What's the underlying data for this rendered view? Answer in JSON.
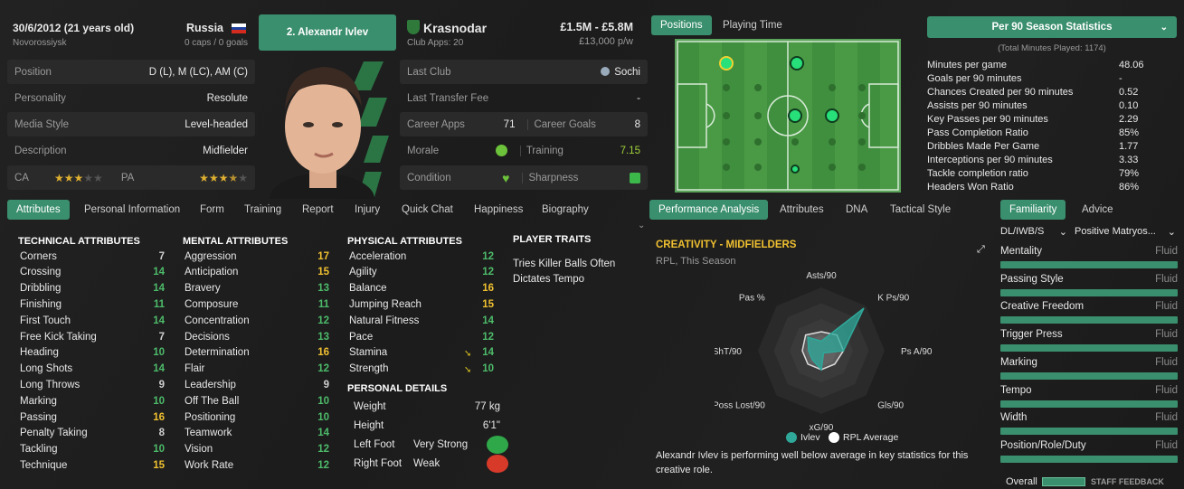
{
  "player": {
    "dob": "30/6/2012 (21 years old)",
    "birthplace": "Novorossiysk",
    "nation": "Russia",
    "caps": "0 caps / 0 goals",
    "name_button": "2. Alexandr Ivlev",
    "club": "Krasnodar",
    "club_apps": "Club Apps: 20",
    "value": "£1.5M - £5.8M",
    "wage": "£13,000 p/w"
  },
  "profile": [
    {
      "label": "Position",
      "value": "D (L), M (LC), AM (C)"
    },
    {
      "label": "Personality",
      "value": "Resolute"
    },
    {
      "label": "Media Style",
      "value": "Level-headed"
    },
    {
      "label": "Description",
      "value": "Midfielder"
    }
  ],
  "ability": {
    "ca_label": "CA",
    "pa_label": "PA",
    "ca_stars": 3,
    "pa_stars": 3.5
  },
  "career": {
    "last_club_label": "Last Club",
    "last_club": "Sochi",
    "last_fee_label": "Last Transfer Fee",
    "last_fee": "-",
    "apps_label": "Career Apps",
    "apps": "71",
    "goals_label": "Career Goals",
    "goals": "8",
    "morale_label": "Morale",
    "training_label": "Training",
    "training": "7.15",
    "condition_label": "Condition",
    "sharpness_label": "Sharpness"
  },
  "pitch_tabs": [
    "Positions",
    "Playing Time"
  ],
  "stats_header": "Per 90 Season Statistics",
  "stats_sub": "(Total Minutes Played: 1174)",
  "stats": [
    {
      "k": "Minutes per game",
      "v": "48.06"
    },
    {
      "k": "Goals per 90 minutes",
      "v": "-"
    },
    {
      "k": "Chances Created per 90 minutes",
      "v": "0.52"
    },
    {
      "k": "Assists per 90 minutes",
      "v": "0.10"
    },
    {
      "k": "Key Passes per 90 minutes",
      "v": "2.29"
    },
    {
      "k": "Pass Completion Ratio",
      "v": "85%"
    },
    {
      "k": "Dribbles Made Per Game",
      "v": "1.77"
    },
    {
      "k": "Interceptions per 90 minutes",
      "v": "3.33"
    },
    {
      "k": "Tackle completion ratio",
      "v": "79%"
    },
    {
      "k": "Headers Won Ratio",
      "v": "86%"
    }
  ],
  "left_tabs": [
    "Attributes",
    "Personal Information",
    "Form",
    "Training",
    "Report",
    "Injury",
    "Quick Chat",
    "Happiness",
    "Biography"
  ],
  "technical": {
    "title": "TECHNICAL ATTRIBUTES",
    "items": [
      {
        "k": "Corners",
        "v": "7"
      },
      {
        "k": "Crossing",
        "v": "14"
      },
      {
        "k": "Dribbling",
        "v": "14"
      },
      {
        "k": "Finishing",
        "v": "11"
      },
      {
        "k": "First Touch",
        "v": "14"
      },
      {
        "k": "Free Kick Taking",
        "v": "7"
      },
      {
        "k": "Heading",
        "v": "10"
      },
      {
        "k": "Long Shots",
        "v": "14"
      },
      {
        "k": "Long Throws",
        "v": "9"
      },
      {
        "k": "Marking",
        "v": "10"
      },
      {
        "k": "Passing",
        "v": "16"
      },
      {
        "k": "Penalty Taking",
        "v": "8"
      },
      {
        "k": "Tackling",
        "v": "10"
      },
      {
        "k": "Technique",
        "v": "15"
      }
    ]
  },
  "mental": {
    "title": "MENTAL ATTRIBUTES",
    "items": [
      {
        "k": "Aggression",
        "v": "17"
      },
      {
        "k": "Anticipation",
        "v": "15"
      },
      {
        "k": "Bravery",
        "v": "13"
      },
      {
        "k": "Composure",
        "v": "11"
      },
      {
        "k": "Concentration",
        "v": "12"
      },
      {
        "k": "Decisions",
        "v": "13"
      },
      {
        "k": "Determination",
        "v": "16"
      },
      {
        "k": "Flair",
        "v": "12"
      },
      {
        "k": "Leadership",
        "v": "9"
      },
      {
        "k": "Off The Ball",
        "v": "10"
      },
      {
        "k": "Positioning",
        "v": "10"
      },
      {
        "k": "Teamwork",
        "v": "14"
      },
      {
        "k": "Vision",
        "v": "12"
      },
      {
        "k": "Work Rate",
        "v": "12"
      }
    ]
  },
  "physical": {
    "title": "PHYSICAL ATTRIBUTES",
    "items": [
      {
        "k": "Acceleration",
        "v": "12"
      },
      {
        "k": "Agility",
        "v": "12"
      },
      {
        "k": "Balance",
        "v": "16"
      },
      {
        "k": "Jumping Reach",
        "v": "15"
      },
      {
        "k": "Natural Fitness",
        "v": "14"
      },
      {
        "k": "Pace",
        "v": "12"
      },
      {
        "k": "Stamina",
        "v": "14"
      },
      {
        "k": "Strength",
        "v": "10"
      }
    ]
  },
  "personal": {
    "title": "PERSONAL DETAILS",
    "weight_label": "Weight",
    "weight": "77 kg",
    "height_label": "Height",
    "height": "6'1\"",
    "left_foot_label": "Left Foot",
    "left_foot": "Very Strong",
    "right_foot_label": "Right Foot",
    "right_foot": "Weak"
  },
  "traits": {
    "title": "PLAYER TRAITS",
    "items": [
      "Tries Killer Balls Often",
      "Dictates Tempo"
    ]
  },
  "perf_tabs": [
    "Performance Analysis",
    "Attributes",
    "DNA",
    "Tactical Style"
  ],
  "perf": {
    "title": "CREATIVITY - MIDFIELDERS",
    "sub": "RPL, This Season",
    "axes": [
      "Asts/90",
      "K Ps/90",
      "Ps A/90",
      "Gls/90",
      "xG/90",
      "Poss Lost/90",
      "ShT/90",
      "Pas %"
    ],
    "legend_player": "Ivlev",
    "legend_avg": "RPL Average",
    "desc": "Alexandr Ivlev is performing well below average in key statistics for this creative role.",
    "player_vals": [
      0.15,
      0.95,
      0.35,
      0.05,
      0.3,
      0.2,
      0.2,
      0.3
    ],
    "avg_vals": [
      0.3,
      0.35,
      0.35,
      0.3,
      0.3,
      0.3,
      0.3,
      0.35
    ]
  },
  "fam_tabs": [
    "Familiarity",
    "Advice"
  ],
  "fam_role": "DL/IWB/S",
  "fam_duty": "Positive Matryos...",
  "familiarity": [
    {
      "k": "Mentality",
      "v": "Fluid"
    },
    {
      "k": "Passing Style",
      "v": "Fluid"
    },
    {
      "k": "Creative Freedom",
      "v": "Fluid"
    },
    {
      "k": "Trigger Press",
      "v": "Fluid"
    },
    {
      "k": "Marking",
      "v": "Fluid"
    },
    {
      "k": "Tempo",
      "v": "Fluid"
    },
    {
      "k": "Width",
      "v": "Fluid"
    },
    {
      "k": "Position/Role/Duty",
      "v": "Fluid"
    }
  ],
  "overall_label": "Overall",
  "staff_feedback": "STAFF FEEDBACK",
  "colors": {
    "accent": "#3a8f6e",
    "green": "#4dbb6a",
    "yellow": "#f0c030"
  }
}
